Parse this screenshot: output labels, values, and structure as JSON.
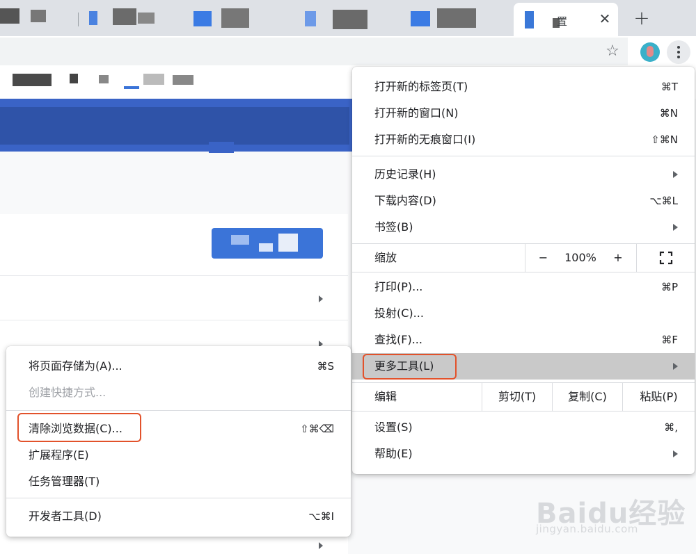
{
  "browser": {
    "active_tab_title": "置",
    "tab_close_glyph": "✕",
    "new_tab_glyph": "+",
    "bookmark_glyph": "☆"
  },
  "chrome_menu": {
    "items": [
      {
        "label": "打开新的标签页(T)",
        "shortcut": "⌘T"
      },
      {
        "label": "打开新的窗口(N)",
        "shortcut": "⌘N"
      },
      {
        "label": "打开新的无痕窗口(I)",
        "shortcut": "⇧⌘N"
      },
      {
        "label": "历史记录(H)",
        "submenu": true
      },
      {
        "label": "下载内容(D)",
        "shortcut": "⌥⌘L"
      },
      {
        "label": "书签(B)",
        "submenu": true
      },
      {
        "label": "打印(P)...",
        "shortcut": "⌘P"
      },
      {
        "label": "投射(C)..."
      },
      {
        "label": "查找(F)...",
        "shortcut": "⌘F"
      },
      {
        "label": "更多工具(L)",
        "submenu": true,
        "highlighted": true
      },
      {
        "label": "设置(S)",
        "shortcut": "⌘,"
      },
      {
        "label": "帮助(E)",
        "submenu": true
      }
    ],
    "zoom": {
      "label": "缩放",
      "minus": "−",
      "value": "100%",
      "plus": "+"
    },
    "edit": {
      "label": "编辑",
      "cut": "剪切(T)",
      "copy": "复制(C)",
      "paste": "粘贴(P)"
    }
  },
  "more_tools_menu": {
    "items": [
      {
        "label": "将页面存储为(A)...",
        "shortcut": "⌘S"
      },
      {
        "label": "创建快捷方式...",
        "disabled": true
      },
      {
        "label": "清除浏览数据(C)...",
        "shortcut": "⇧⌘⌫",
        "highlighted": true
      },
      {
        "label": "扩展程序(E)"
      },
      {
        "label": "任务管理器(T)"
      },
      {
        "label": "开发者工具(D)",
        "shortcut": "⌥⌘I"
      }
    ]
  },
  "watermark": {
    "main": "Baidu经验",
    "sub": "jingyan.baidu.com"
  },
  "colors": {
    "highlight_outline": "#e2522b",
    "accent_blue": "#3b74d8",
    "banner_blue": "#3a63c6"
  }
}
